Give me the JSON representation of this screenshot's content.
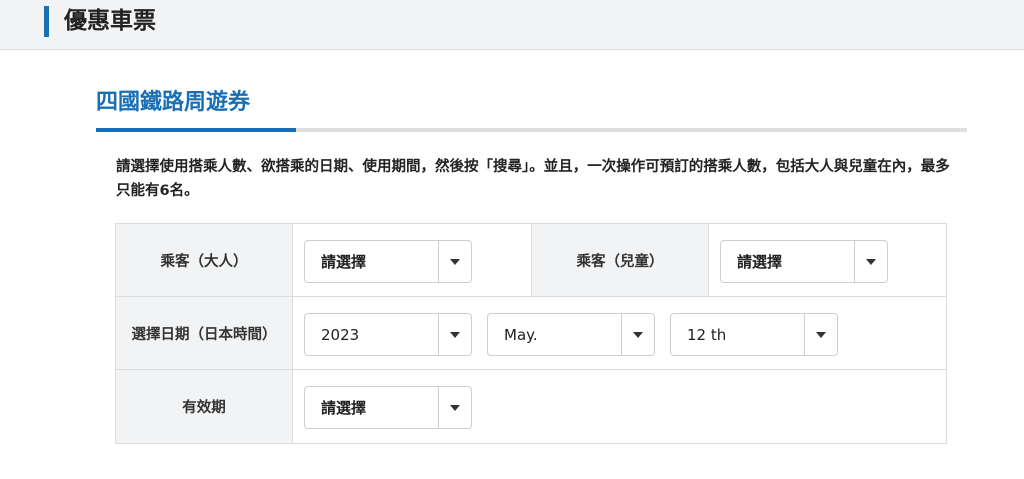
{
  "header": {
    "title": "優惠車票"
  },
  "section": {
    "title": "四國鐵路周遊券"
  },
  "instructions": "請選擇使用搭乘人數、欲搭乘的日期、使用期間，然後按「搜尋」。並且，一次操作可預訂的搭乘人數，包括大人與兒童在內，最多只能有6名。",
  "form": {
    "adult_label": "乘客（大人）",
    "adult_value": "請選擇",
    "child_label": "乘客（兒童）",
    "child_value": "請選擇",
    "date_label": "選擇日期（日本時間）",
    "year_value": "2023",
    "month_value": "May.",
    "day_value": "12 th",
    "validity_label": "有效期",
    "validity_value": "請選擇"
  },
  "colors": {
    "accent": "#1a6fb4",
    "label_bg": "#f2f3f4",
    "border": "#dcdcdc"
  },
  "icons": {
    "dropdown": "chevron-down-icon"
  }
}
